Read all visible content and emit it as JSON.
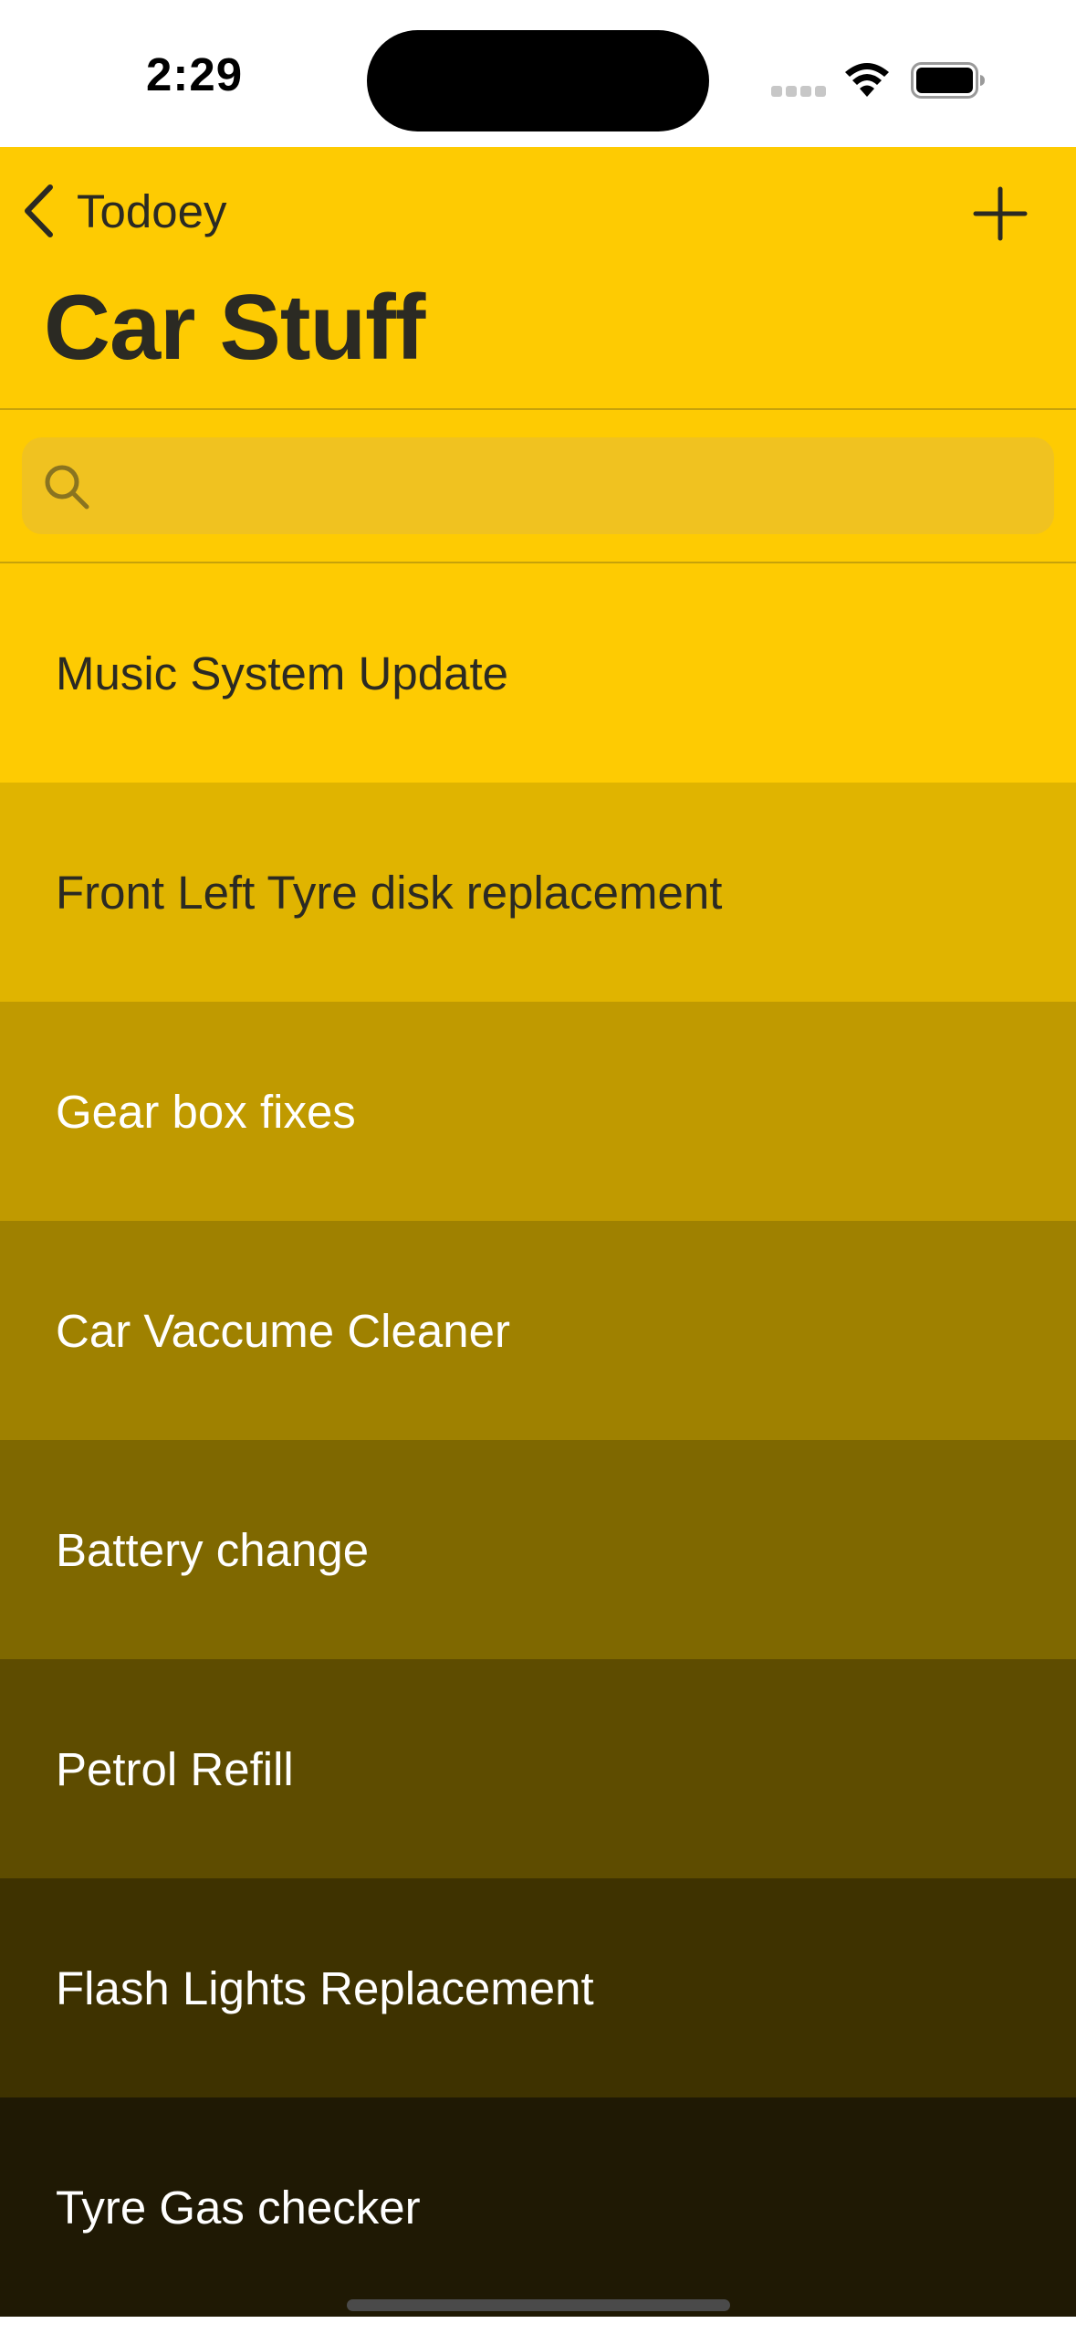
{
  "status_bar": {
    "time": "2:29",
    "icons": [
      "cellular-signal-icon",
      "wifi-icon",
      "battery-icon"
    ]
  },
  "nav": {
    "back_label": "Todoey",
    "back_icon": "chevron-left-icon",
    "add_icon": "plus-icon",
    "title": "Car Stuff",
    "background_color": "#fecb02"
  },
  "search": {
    "placeholder": "",
    "value": "",
    "icon": "magnifying-glass-icon"
  },
  "todos": [
    {
      "label": "Music System Update",
      "bg": "#fecb02",
      "text_color": "#2b2a23"
    },
    {
      "label": "Front Left Tyre disk replacement",
      "bg": "#e0b400",
      "text_color": "#2b2a23"
    },
    {
      "label": "Gear box fixes",
      "bg": "#c09a00",
      "text_color": "#ffffff"
    },
    {
      "label": "Car Vaccume Cleaner",
      "bg": "#9f8100",
      "text_color": "#ffffff"
    },
    {
      "label": "Battery change",
      "bg": "#7f6800",
      "text_color": "#ffffff"
    },
    {
      "label": "Petrol Refill",
      "bg": "#5e4c00",
      "text_color": "#ffffff"
    },
    {
      "label": "Flash Lights Replacement",
      "bg": "#3e3200",
      "text_color": "#ffffff"
    },
    {
      "label": "Tyre Gas checker",
      "bg": "#1f1904",
      "text_color": "#ffffff"
    }
  ]
}
